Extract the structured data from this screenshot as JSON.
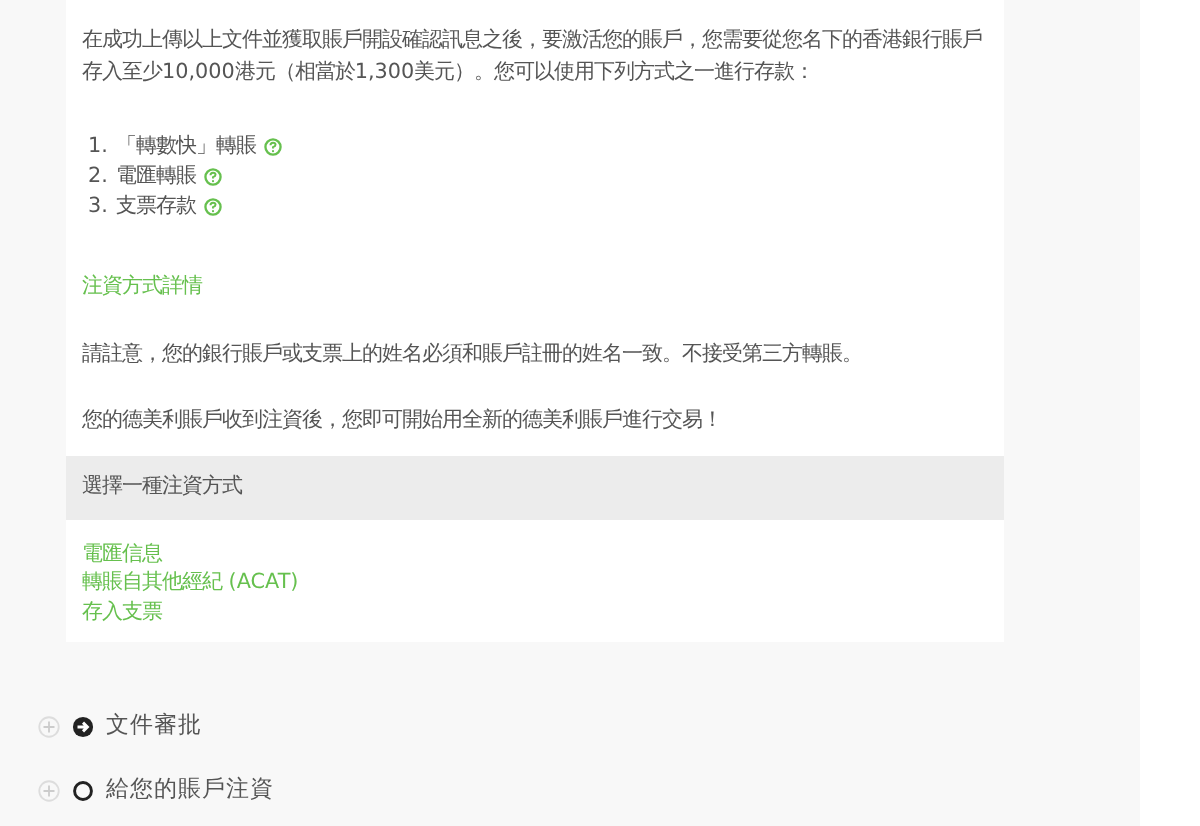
{
  "intro": "在成功上傳以上文件並獲取賬戶開設確認訊息之後，要激活您的賬戶，您需要從您名下的香港銀行賬戶存入至少10,000港元（相當於1,300美元）。您可以使用下列方式之一進行存款：",
  "methods": [
    {
      "number": "1.",
      "label": "「轉數快」轉賬"
    },
    {
      "number": "2.",
      "label": "電匯轉賬"
    },
    {
      "number": "3.",
      "label": "支票存款"
    }
  ],
  "details_link": "注資方式詳情",
  "notes": [
    "請註意，您的銀行賬戶或支票上的姓名必須和賬戶註冊的姓名一致。不接受第三方轉賬。",
    "您的德美利賬戶收到注資後，您即可開始用全新的德美利賬戶進行交易！"
  ],
  "choose_header": "選擇一種注資方式",
  "choose_links": [
    "電匯信息",
    "轉賬自其他經紀 (ACAT)",
    "存入支票"
  ],
  "steps": [
    {
      "label": "文件審批",
      "current": true
    },
    {
      "label": "給您的賬戶注資",
      "current": false
    }
  ]
}
